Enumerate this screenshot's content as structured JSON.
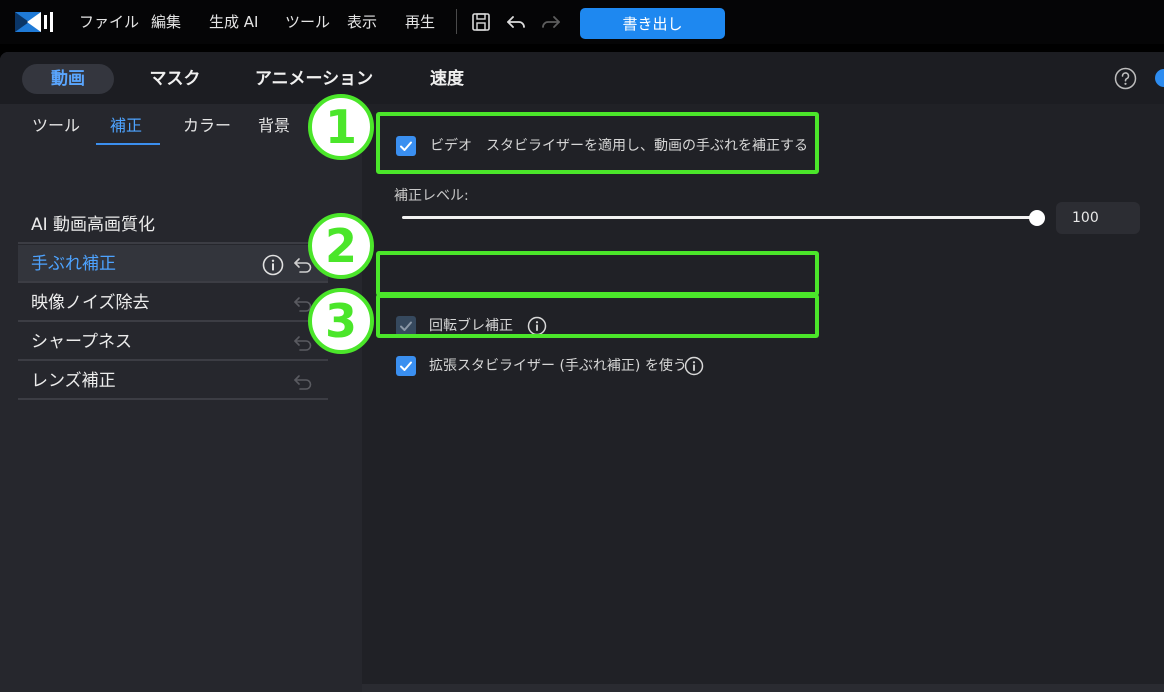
{
  "menu": {
    "items": [
      "ファイル",
      "編集",
      "生成 AI",
      "ツール",
      "表示",
      "再生"
    ],
    "export_label": "書き出し"
  },
  "tabs": {
    "main": [
      "動画",
      "マスク",
      "アニメーション",
      "速度"
    ],
    "active_main": "動画",
    "sub": [
      "ツール",
      "補正",
      "カラー",
      "背景"
    ],
    "active_sub": "補正"
  },
  "sidebar": {
    "items": [
      {
        "label": "AI 動画高画質化"
      },
      {
        "label": "手ぶれ補正"
      },
      {
        "label": "映像ノイズ除去"
      },
      {
        "label": "シャープネス"
      },
      {
        "label": "レンズ補正"
      }
    ],
    "selected": "手ぶれ補正"
  },
  "stabilizer": {
    "video_option": {
      "label": "ビデオ　スタビライザーを適用し、動画の手ぶれを補正する",
      "checked": true
    },
    "level_label": "補正レベル:",
    "level_value": "100",
    "level_fraction": 1.0,
    "rotation_option": {
      "label": "回転ブレ補正",
      "checked": true,
      "disabled": true
    },
    "extended_option": {
      "label": "拡張スタビライザー (手ぶれ補正) を使う",
      "checked": true
    }
  },
  "annotations": {
    "badges": [
      "1",
      "2",
      "3"
    ]
  },
  "colors": {
    "accent": "#1e88f0",
    "active_text": "#4da3ff",
    "highlight": "#4be62a"
  },
  "icons": [
    "app-logo-icon",
    "save-icon",
    "undo-icon",
    "redo-icon",
    "help-icon",
    "info-icon",
    "reset-icon",
    "checkmark-icon"
  ]
}
